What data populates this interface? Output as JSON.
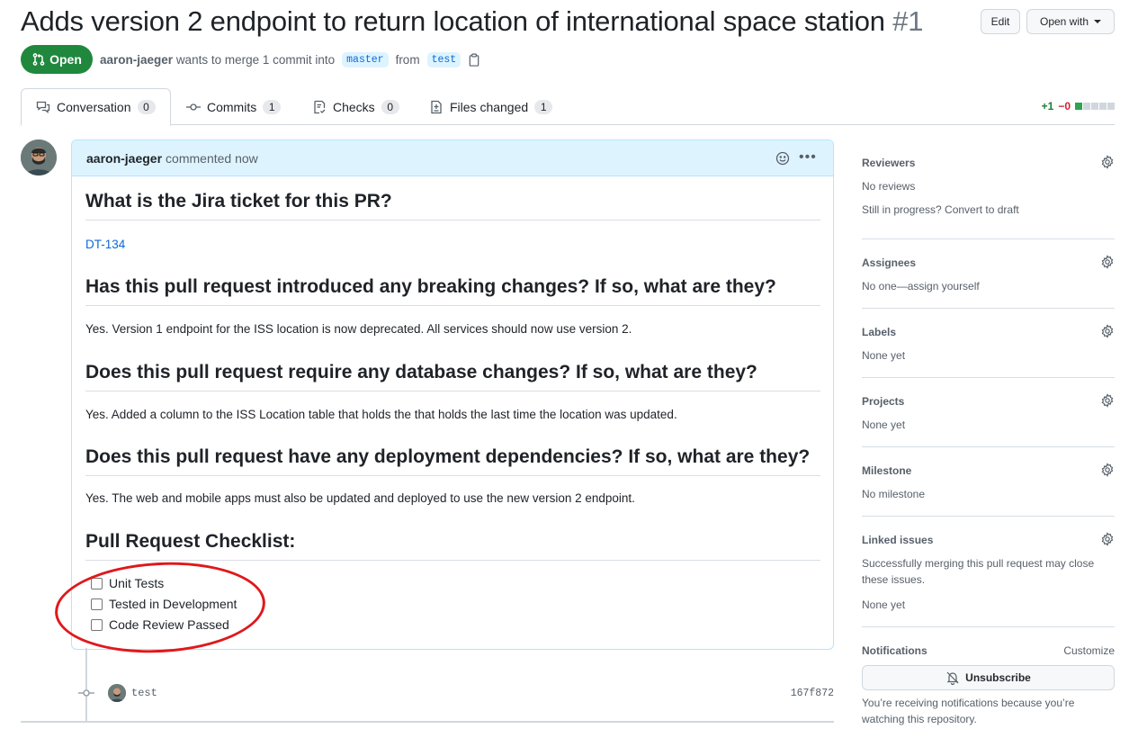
{
  "pr": {
    "title": "Adds version 2 endpoint to return location of international space station",
    "number": "#1",
    "edit_label": "Edit",
    "open_with_label": "Open with",
    "state": "Open",
    "author": "aaron-jaeger",
    "merge_text": "wants to merge 1 commit into",
    "base_branch": "master",
    "from_text": "from",
    "head_branch": "test"
  },
  "tabs": [
    {
      "label": "Conversation",
      "count": "0",
      "icon": "comment-discussion-icon"
    },
    {
      "label": "Commits",
      "count": "1",
      "icon": "git-commit-icon"
    },
    {
      "label": "Checks",
      "count": "0",
      "icon": "checklist-icon"
    },
    {
      "label": "Files changed",
      "count": "1",
      "icon": "file-diff-icon"
    }
  ],
  "diffstat": {
    "additions": "+1",
    "deletions": "−0"
  },
  "comment": {
    "author": "aaron-jaeger",
    "action": "commented now",
    "sections": [
      {
        "heading": "What is the Jira ticket for this PR?",
        "text": "DT-134"
      },
      {
        "heading": "Has this pull request introduced any breaking changes? If so, what are they?",
        "text": "Yes. Version 1 endpoint for the ISS location is now deprecated. All services should now use version 2."
      },
      {
        "heading": "Does this pull request require any database changes? If so, what are they?",
        "text": "Yes. Added a column to the ISS Location table that holds the that holds the last time the location was updated."
      },
      {
        "heading": "Does this pull request have any deployment dependencies? If so, what are they?",
        "text": "Yes. The web and mobile apps must also be updated and deployed to use the new version 2 endpoint."
      }
    ],
    "checklist_heading": "Pull Request Checklist:",
    "checklist": [
      "Unit Tests",
      "Tested in Development",
      "Code Review Passed"
    ]
  },
  "commit": {
    "message": "test",
    "sha": "167f872"
  },
  "sidebar": {
    "reviewers": {
      "title": "Reviewers",
      "line1": "No reviews",
      "line2": "Still in progress? Convert to draft"
    },
    "assignees": {
      "title": "Assignees",
      "line1": "No one—assign yourself"
    },
    "labels": {
      "title": "Labels",
      "line1": "None yet"
    },
    "projects": {
      "title": "Projects",
      "line1": "None yet"
    },
    "milestone": {
      "title": "Milestone",
      "line1": "No milestone"
    },
    "linked_issues": {
      "title": "Linked issues",
      "line1": "Successfully merging this pull request may close",
      "line2": "these issues.",
      "line3": "None yet"
    },
    "notifications": {
      "title": "Notifications",
      "customize": "Customize",
      "unsubscribe": "Unsubscribe",
      "line1": "You’re receiving notifications because you’re",
      "line2": "watching this repository."
    }
  },
  "colors": {
    "open_green": "#1f883d",
    "link_blue": "#0969da",
    "annotation_red": "#e0181b"
  }
}
